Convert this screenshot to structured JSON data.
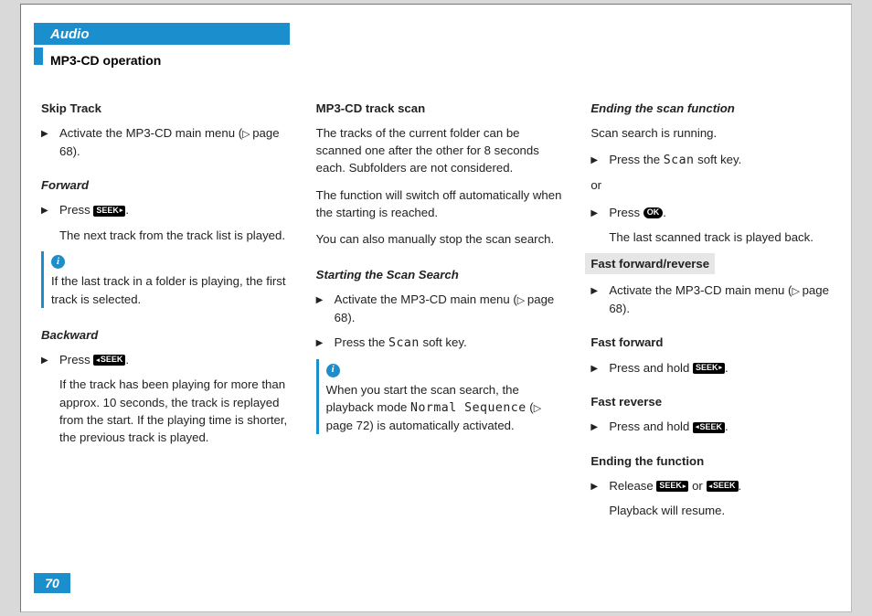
{
  "header": {
    "tab": "Audio",
    "section": "MP3-CD operation"
  },
  "page_number": "70",
  "icons": {
    "seek_fwd": "SEEK",
    "seek_back": "SEEK",
    "ok": "OK"
  },
  "col1": {
    "skip_track_h": "Skip Track",
    "activate_menu": "Activate the MP3-CD main menu (",
    "page68": " page 68).",
    "forward_h": "Forward",
    "press": "Press ",
    "next_track": "The next track from the track list is played.",
    "note1": "If the last track in a folder is playing, the first track is selected.",
    "backward_h": "Backward",
    "back_explain": "If the track has been playing for more than approx. 10 seconds, the track is replayed from the start. If the playing time is shorter, the previous track is played."
  },
  "col2": {
    "trackscan_h": "MP3-CD track scan",
    "p1": "The tracks of the current folder can be scanned one after the other for 8 seconds each. Subfolders are not considered.",
    "p2": "The function will switch off automatically when the starting is reached.",
    "p3": "You can also manually stop the scan search.",
    "start_h": "Starting the Scan Search",
    "press_the": "Press the ",
    "scan_label": "Scan",
    "soft_key": " soft key.",
    "note2a": "When you start the scan search, the playback mode ",
    "normal_seq": "Normal Sequence",
    "note2b": " (",
    "page72": " page 72) is automatically activated."
  },
  "col3": {
    "end_scan_h": "Ending the scan function",
    "scan_running": "Scan search is running.",
    "or": "or",
    "last_scanned": "The last scanned track is played back.",
    "ffrev_h": "Fast forward/reverse",
    "fast_fwd_h": "Fast forward",
    "press_hold": "Press and hold ",
    "fast_rev_h": "Fast reverse",
    "end_func_h": "Ending the function",
    "release": "Release ",
    "or_word": " or ",
    "resume": "Playback will resume."
  }
}
